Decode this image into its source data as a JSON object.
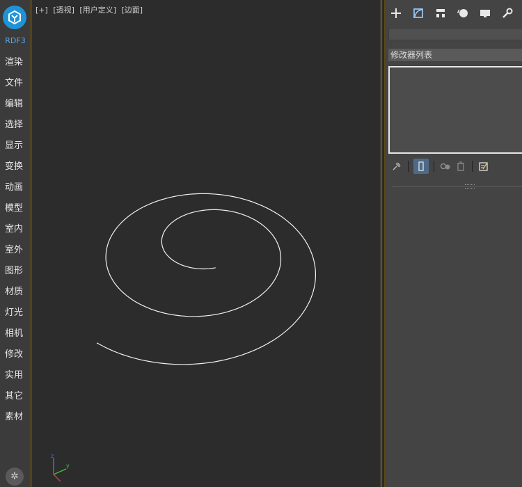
{
  "app": {
    "brand": "RDF3"
  },
  "sidebar": {
    "items": [
      {
        "label": "渲染"
      },
      {
        "label": "文件"
      },
      {
        "label": "编辑"
      },
      {
        "label": "选择"
      },
      {
        "label": "显示"
      },
      {
        "label": "变换"
      },
      {
        "label": "动画"
      },
      {
        "label": "模型"
      },
      {
        "label": "室内"
      },
      {
        "label": "室外"
      },
      {
        "label": "图形"
      },
      {
        "label": "材质"
      },
      {
        "label": "灯光"
      },
      {
        "label": "相机"
      },
      {
        "label": "修改"
      },
      {
        "label": "实用"
      },
      {
        "label": "其它"
      },
      {
        "label": "素材"
      }
    ]
  },
  "viewport": {
    "labels": [
      "[+]",
      "[透视]",
      "[用户定义]",
      "[边面]"
    ]
  },
  "panel": {
    "modifier_list_label": "修改器列表",
    "name_field_value": ""
  },
  "colors": {
    "accent": "#1f93d8",
    "viewport_border": "#c89a2e",
    "active_tool": "#4f6a86"
  }
}
